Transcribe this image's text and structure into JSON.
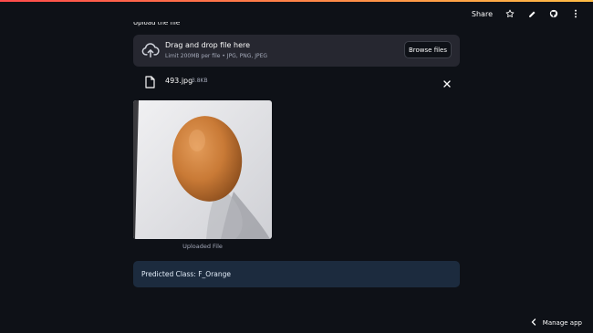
{
  "header": {
    "share_label": "Share",
    "icons": [
      "star-icon",
      "edit-icon",
      "github-icon",
      "more-vertical-icon"
    ]
  },
  "uploader": {
    "label": "Upload the file",
    "title": "Drag and drop file here",
    "limits": "Limit 200MB per file • JPG, PNG, JPEG",
    "browse_label": "Browse files"
  },
  "file": {
    "name": "493.jpg",
    "size": "3.8KB"
  },
  "image": {
    "caption": "Uploaded File"
  },
  "result": {
    "text": "Predicted Class: F_Orange",
    "color": "#1c2b3e"
  },
  "footer": {
    "manage_label": "Manage app"
  },
  "colors": {
    "background": "#0e1117",
    "panel": "#262730",
    "accent_start": "#ff4b4b",
    "accent_end": "#ffbd45"
  }
}
